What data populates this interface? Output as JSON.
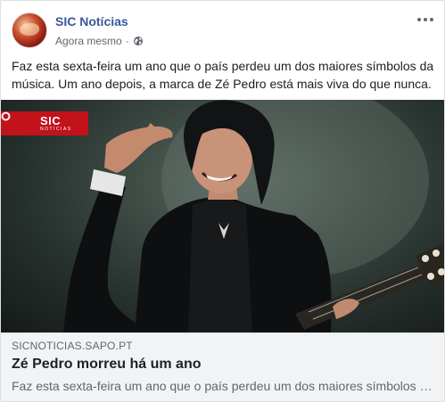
{
  "post": {
    "page_name": "SIC Notícias",
    "timestamp": "Agora mesmo",
    "separator": "·",
    "privacy_icon": "globe-icon",
    "avatar_icon": "globe-logo",
    "more_icon": "ellipsis-icon",
    "text": "Faz esta sexta-feira um ano que o país perdeu um dos maiores símbolos da música. Um ano depois, a marca de Zé Pedro está mais viva do que nunca."
  },
  "photo": {
    "logo_main": "SIC",
    "logo_sub": "NOTÍCIAS"
  },
  "link": {
    "domain": "SICNOTICIAS.SAPO.PT",
    "title": "Zé Pedro morreu há um ano",
    "description": "Faz esta sexta-feira um ano que o país perdeu um dos maiores símbolos da música. Um ano depois, a marca de Zé Pedro está mais viva do que nunca."
  },
  "colors": {
    "page_name": "#385898",
    "logo_red": "#c2121a",
    "link_bg": "#f2f3f5"
  }
}
